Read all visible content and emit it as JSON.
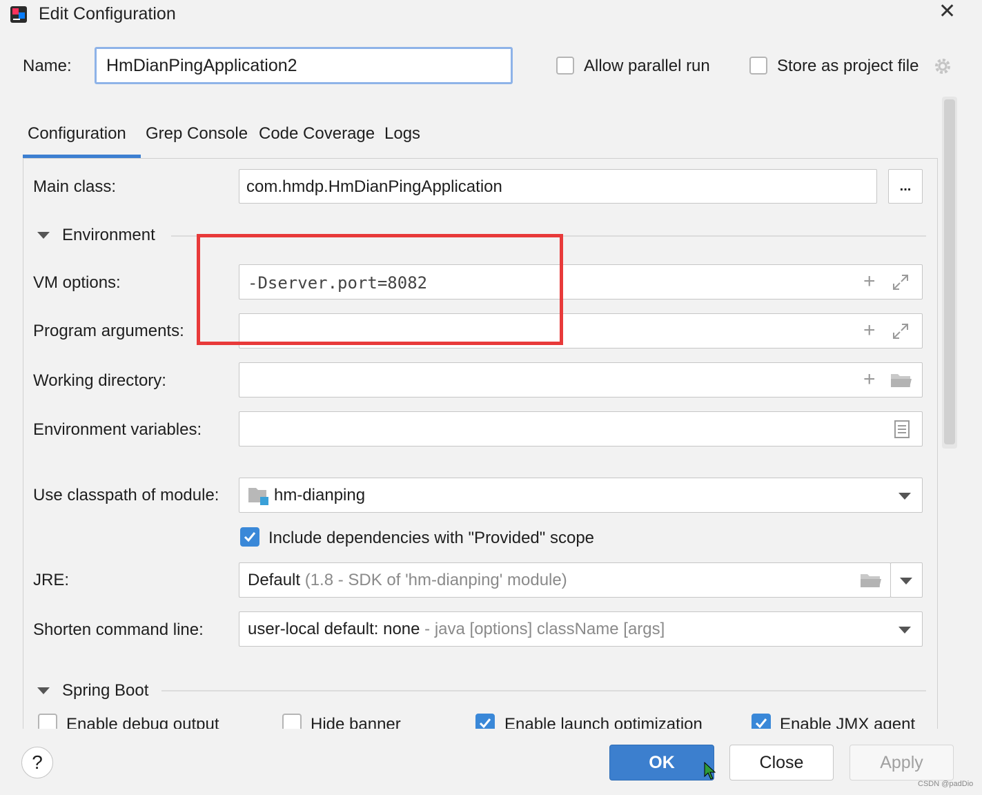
{
  "window": {
    "title": "Edit Configuration"
  },
  "top": {
    "name_label": "Name:",
    "name_value": "HmDianPingApplication2",
    "allow_parallel_label": "Allow parallel run",
    "allow_parallel_checked": false,
    "store_project_label": "Store as project file",
    "store_project_checked": false
  },
  "tabs": [
    {
      "label": "Configuration",
      "active": true
    },
    {
      "label": "Grep Console",
      "active": false
    },
    {
      "label": "Code Coverage",
      "active": false
    },
    {
      "label": "Logs",
      "active": false
    }
  ],
  "form": {
    "main_class_label": "Main class:",
    "main_class_value": "com.hmdp.HmDianPingApplication",
    "browse_label": "...",
    "environment_label": "Environment",
    "vm_options_label": "VM options:",
    "vm_options_value": "-Dserver.port=8082",
    "program_args_label": "Program arguments:",
    "program_args_value": "",
    "working_dir_label": "Working directory:",
    "working_dir_value": "",
    "env_vars_label": "Environment variables:",
    "env_vars_value": "",
    "classpath_label": "Use classpath of module:",
    "classpath_value": "hm-dianping",
    "include_deps_label": "Include dependencies with \"Provided\" scope",
    "include_deps_checked": true,
    "jre_label": "JRE:",
    "jre_value": "Default",
    "jre_hint": "(1.8 - SDK of 'hm-dianping' module)",
    "shorten_label": "Shorten command line:",
    "shorten_value": "user-local default: none",
    "shorten_hint": "- java [options] className [args]"
  },
  "spring_boot": {
    "section_label": "Spring Boot",
    "options": [
      {
        "label": "Enable debug output",
        "checked": false
      },
      {
        "label": "Hide banner",
        "checked": false
      },
      {
        "label": "Enable launch optimization",
        "checked": true
      },
      {
        "label": "Enable JMX agent",
        "checked": true
      }
    ]
  },
  "buttons": {
    "help": "?",
    "ok": "OK",
    "close": "Close",
    "apply": "Apply"
  },
  "watermark": "CSDN @padDio",
  "colors": {
    "accent": "#3d7fd1",
    "ok_button": "#3c7fce",
    "highlight_box": "#e83a3a"
  }
}
